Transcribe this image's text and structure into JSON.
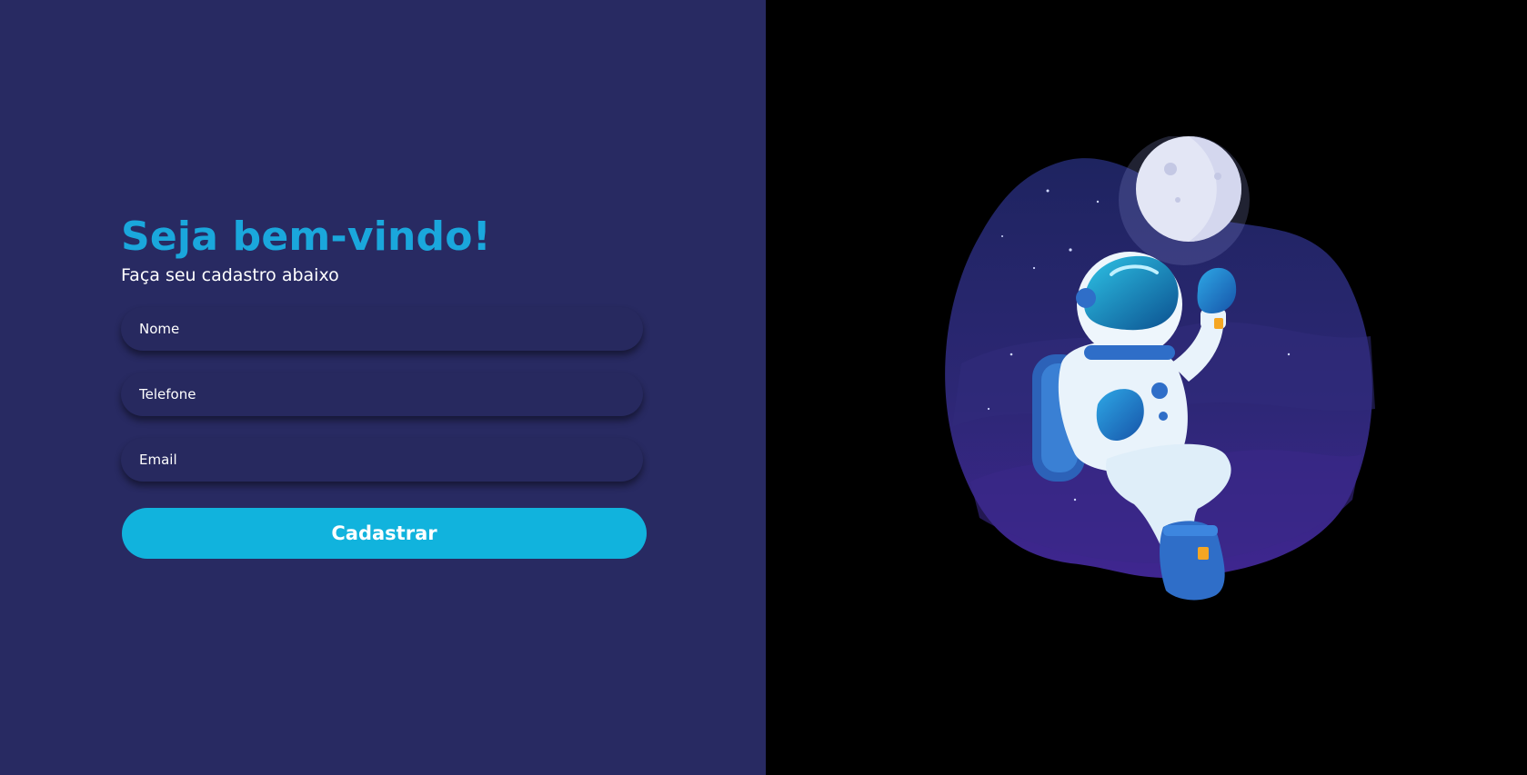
{
  "colors": {
    "left_background": "#282a62",
    "right_background": "#000000",
    "accent": "#11b3dd",
    "title": "#1aa7dc",
    "text": "#ffffff"
  },
  "header": {
    "title": "Seja bem-vindo!",
    "subtitle": "Faça seu cadastro abaixo"
  },
  "form": {
    "name_placeholder": "Nome",
    "phone_placeholder": "Telefone",
    "email_placeholder": "Email",
    "submit_label": "Cadastrar"
  },
  "illustration": {
    "subject": "astronaut-with-moon"
  }
}
